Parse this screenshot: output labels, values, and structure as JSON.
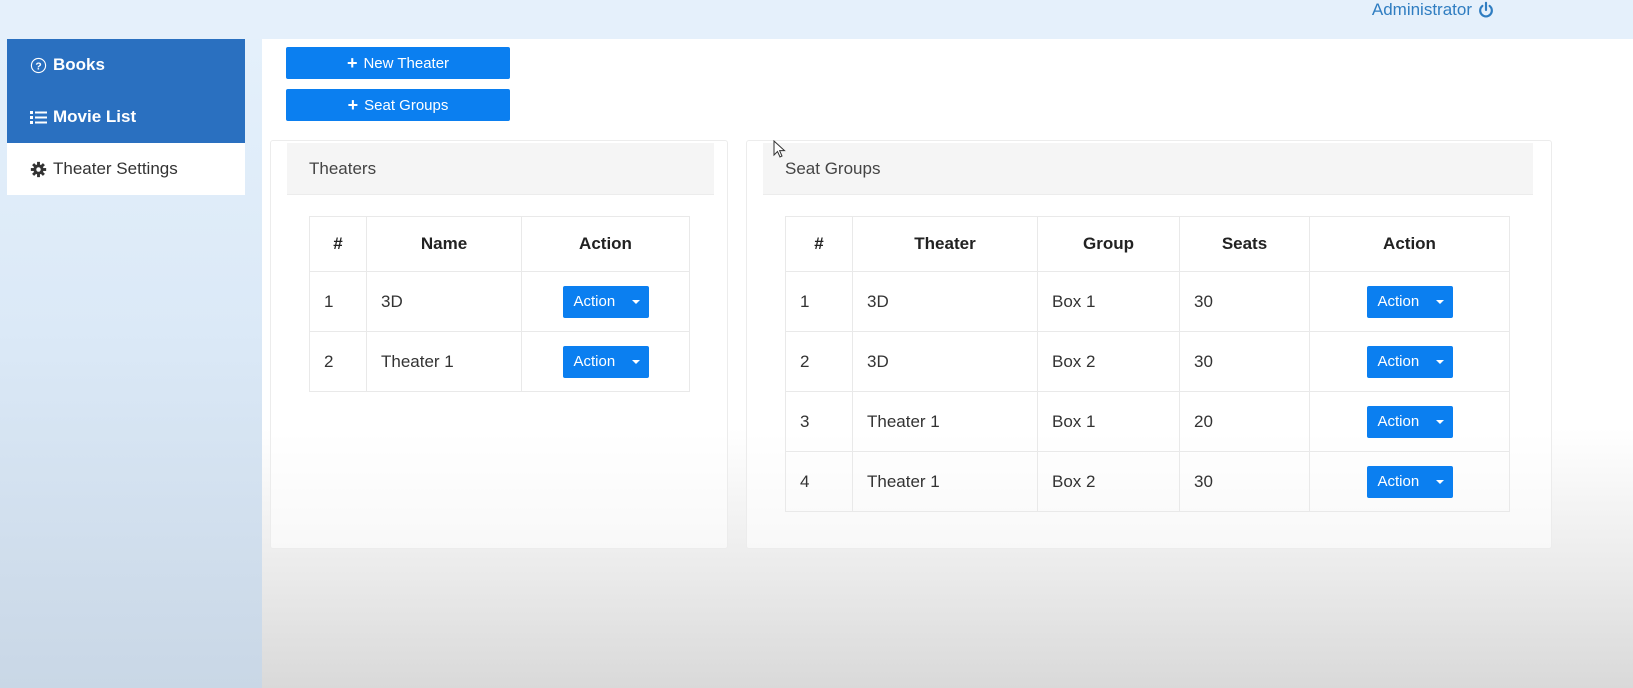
{
  "header": {
    "user_label": "Administrator"
  },
  "sidebar": {
    "items": [
      {
        "label": "Books",
        "icon": "question-circle-icon"
      },
      {
        "label": "Movie List",
        "icon": "list-icon"
      },
      {
        "label": "Theater Settings",
        "icon": "gear-icon"
      }
    ]
  },
  "toolbar": {
    "new_theater_label": "New Theater",
    "seat_groups_label": "Seat Groups"
  },
  "theaters_panel": {
    "title": "Theaters",
    "columns": [
      "#",
      "Name",
      "Action"
    ],
    "rows": [
      {
        "num": "1",
        "name": "3D",
        "action": "Action"
      },
      {
        "num": "2",
        "name": "Theater 1",
        "action": "Action"
      }
    ]
  },
  "seat_groups_panel": {
    "title": "Seat Groups",
    "columns": [
      "#",
      "Theater",
      "Group",
      "Seats",
      "Action"
    ],
    "rows": [
      {
        "num": "1",
        "theater": "3D",
        "group": "Box 1",
        "seats": "30",
        "action": "Action"
      },
      {
        "num": "2",
        "theater": "3D",
        "group": "Box 2",
        "seats": "30",
        "action": "Action"
      },
      {
        "num": "3",
        "theater": "Theater 1",
        "group": "Box 1",
        "seats": "20",
        "action": "Action"
      },
      {
        "num": "4",
        "theater": "Theater 1",
        "group": "Box 2",
        "seats": "30",
        "action": "Action"
      }
    ]
  },
  "colors": {
    "accent": "#0b7ff0",
    "sidebar_active": "#2a70c0",
    "header_link": "#2f7dc1"
  }
}
